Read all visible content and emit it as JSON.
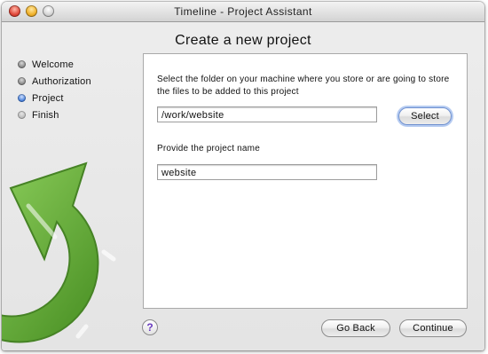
{
  "window": {
    "title": "Timeline - Project Assistant"
  },
  "heading": "Create a new project",
  "steps": [
    {
      "label": "Welcome",
      "state": "done"
    },
    {
      "label": "Authorization",
      "state": "done"
    },
    {
      "label": "Project",
      "state": "active"
    },
    {
      "label": "Finish",
      "state": "pending"
    }
  ],
  "folder": {
    "instruction": "Select the folder on your machine where you store or are going to store the files to be added to this project",
    "value": "/work/website",
    "select_label": "Select"
  },
  "name": {
    "instruction": "Provide the project name",
    "value": "website"
  },
  "footer": {
    "help_label": "?",
    "back_label": "Go Back",
    "continue_label": "Continue"
  },
  "colors": {
    "logo_green": "#5aa52a",
    "active_step": "#3c77d6",
    "help_glyph": "#6a3cc1"
  }
}
